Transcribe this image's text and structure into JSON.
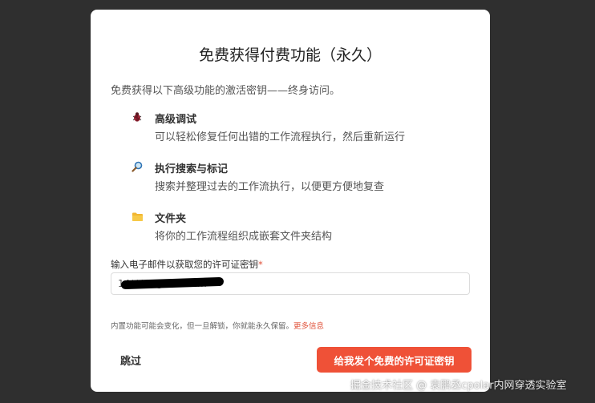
{
  "modal": {
    "title": "免费获得付费功能（永久）",
    "intro": "免费获得以下高级功能的激活密钥——终身访问。",
    "features": [
      {
        "icon": "bug-icon",
        "name": "高级调试",
        "desc": "可以轻松修复任何出错的工作流程执行，然后重新运行"
      },
      {
        "icon": "magnifier-icon",
        "name": "执行搜索与标记",
        "desc": "搜索并整理过去的工作流执行，以便更方便地复查"
      },
      {
        "icon": "folder-icon",
        "name": "文件夹",
        "desc": "将你的工作流程组织成嵌套文件夹结构"
      }
    ],
    "email": {
      "label": "输入电子邮件以获取您的许可证密钥",
      "required_mark": "*",
      "value": "14*****@****.com"
    },
    "note": {
      "text": "内置功能可能会变化，但一旦解锁，你就能永久保留。",
      "link": "更多信息"
    },
    "skip_label": "跳过",
    "cta_label": "给我发个免费的许可证密钥"
  },
  "watermark": "掘金技术社区 @ 袁鹏丞cpolar内网穿透实验室",
  "colors": {
    "accent": "#ef5137",
    "backdrop": "#2f2f2f"
  }
}
